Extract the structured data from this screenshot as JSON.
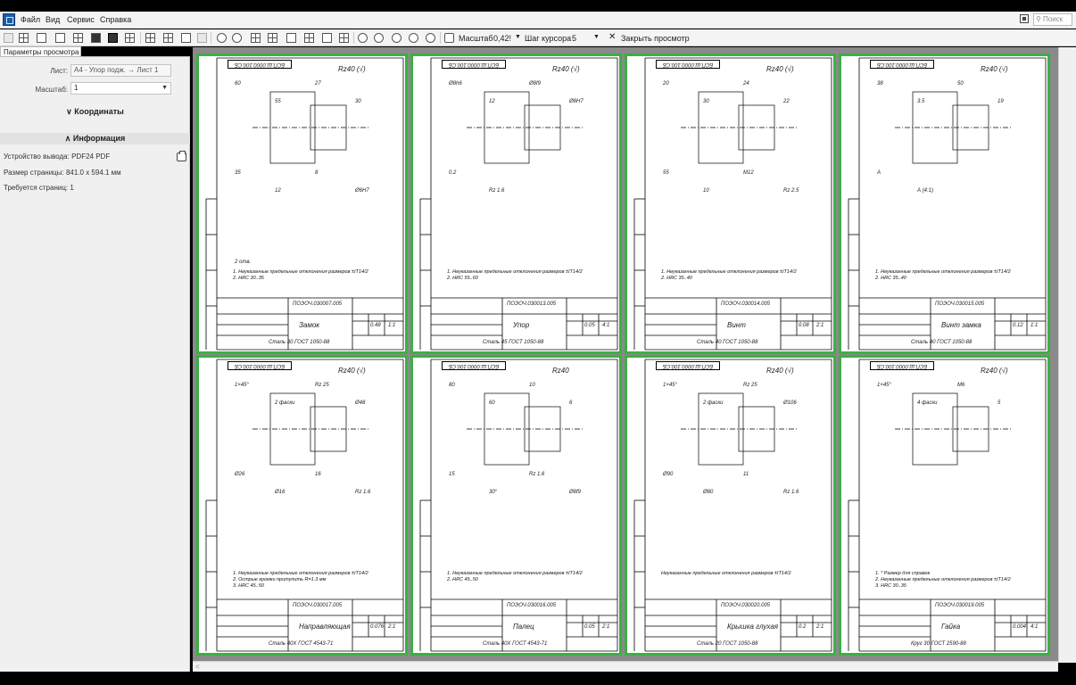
{
  "menubar": {
    "items": [
      "Файл",
      "Вид",
      "Сервис",
      "Справка"
    ],
    "search_placeholder": "Поиск"
  },
  "toolbar": {
    "scale_label": "Масштаб",
    "scale_value": "0,42!",
    "cursor_step_label": "Шаг курсора",
    "cursor_step_value": "5",
    "close_preview_label": "Закрыть просмотр"
  },
  "sidebar": {
    "tab_label": "Параметры просмотра",
    "sheet_label": "Лист:",
    "sheet_value": "А4 - Упор подж. → Лист 1",
    "scale_label": "Масштаб:",
    "scale_value": "1",
    "coords_label": "Координаты",
    "info_label": "Информация",
    "output_device_label": "Устройство вывода:",
    "output_device_value": "PDF24 PDF",
    "page_size_label": "Размер страницы:",
    "page_size_value": "841.0 x 594.1 мм",
    "pages_required_label": "Требуется страниц:",
    "pages_required_value": "1"
  },
  "sheets": [
    {
      "code": "БСП.Ш.0000.100.СБ",
      "roughness": "Rz40 (√)",
      "notes": [
        "1. Неуказанные предельные отклонения размеров ±IT14/2",
        "2. HRC 30..35"
      ],
      "doc_no": "ПОЭОЧ.030007.005",
      "part_name": "Замок",
      "material": "Сталь 30 ГОСТ 1050-88",
      "mass": "0.48",
      "scale": "1:1",
      "dims": [
        "60",
        "55",
        "27",
        "30",
        "35",
        "12",
        "8",
        "Ø6Н7",
        "2 отв."
      ]
    },
    {
      "code": "БСП.Ш.0000.100.СБ",
      "roughness": "Rz40 (√)",
      "notes": [
        "1. Неуказанные предельные отклонения размеров ±IT14/2",
        "2. HRC 55..60"
      ],
      "doc_no": "ПОЭОЧ.030013.005",
      "part_name": "Упор",
      "material": "Сталь 45 ГОСТ 1050-88",
      "mass": "0.05",
      "scale": "4:1",
      "dims": [
        "Ø8h6",
        "12",
        "Ø8f9",
        "Ø8Н7",
        "0.2",
        "Rz 1.6"
      ]
    },
    {
      "code": "БСП.Ш.0000.100.СБ",
      "roughness": "Rz40 (√)",
      "notes": [
        "1. Неуказанные предельные отклонения размеров ±IT14/2",
        "2. HRC 35..40"
      ],
      "doc_no": "ПОЭОЧ.030014.005",
      "part_name": "Винт",
      "material": "Сталь 40 ГОСТ 1050-88",
      "mass": "0.08",
      "scale": "2:1",
      "dims": [
        "20",
        "30",
        "24",
        "22",
        "55",
        "10",
        "М12",
        "Rz 2.5"
      ]
    },
    {
      "code": "БСП.Ш.0000.100.СБ",
      "roughness": "Rz40 (√)",
      "notes": [
        "1. Неуказанные предельные отклонения размеров ±IT14/2",
        "2. HRC 35..40"
      ],
      "doc_no": "ПОЭОЧ.030015.005",
      "part_name": "Винт замка",
      "material": "Сталь 40 ГОСТ 1050-88",
      "mass": "0.12",
      "scale": "1:1",
      "dims": [
        "38",
        "3.5",
        "50",
        "19",
        "A",
        "А (4:1)"
      ]
    },
    {
      "code": "БСП.Ш.0000.100.СБ",
      "roughness": "Rz40 (√)",
      "notes": [
        "1. Неуказанные предельные отклонения размеров ±IT14/2",
        "2. Острые кромки притупить R=1.3 мм",
        "3. HRC 45..50"
      ],
      "doc_no": "ПОЭОЧ.030017.005",
      "part_name": "Направляющая",
      "material": "Сталь 40Х ГОСТ 4543-71",
      "mass": "0.076",
      "scale": "2:1",
      "dims": [
        "1×45°",
        "2 фаски",
        "Rz 25",
        "Ø48",
        "Ø26",
        "Ø16",
        "16",
        "Rz 1.6"
      ]
    },
    {
      "code": "БСП.Ш.0000.100.СБ",
      "roughness": "Rz40",
      "notes": [
        "1. Неуказанные предельные отклонения размеров ±IT14/2",
        "2. HRC 45..50"
      ],
      "doc_no": "ПОЭОЧ.030016.005",
      "part_name": "Палец",
      "material": "Сталь 40Х ГОСТ 4543-71",
      "mass": "0.05",
      "scale": "2:1",
      "dims": [
        "80",
        "60",
        "10",
        "6",
        "15",
        "30°",
        "Rz 1.6",
        "Ø8f9"
      ]
    },
    {
      "code": "БСП.Ш.0000.100.СБ",
      "roughness": "Rz40 (√)",
      "notes": [
        "Неуказанные предельные отклонения размеров ±IT14/2"
      ],
      "doc_no": "ПОЭОЧ.030020.005",
      "part_name": "Крышка глухая",
      "material": "Сталь 20 ГОСТ 1050-88",
      "mass": "0.2",
      "scale": "2:1",
      "dims": [
        "1×45°",
        "2 фаски",
        "Rz 25",
        "Ø106",
        "Ø90",
        "Ø80",
        "11",
        "Rz 1.6"
      ]
    },
    {
      "code": "БСП.Ш.0000.100.СБ",
      "roughness": "Rz40 (√)",
      "notes": [
        "1. * Размер для справок",
        "2. Неуказанные предельные отклонения размеров ±IT14/2",
        "3. HRC 30..35"
      ],
      "doc_no": "ПОЭОЧ.030019.005",
      "part_name": "Гайка",
      "material": "Круг 30 ГОСТ 2590-88",
      "mass": "0.004",
      "scale": "4:1",
      "dims": [
        "1×45°",
        "4 фаски",
        "М6",
        "5"
      ]
    }
  ]
}
